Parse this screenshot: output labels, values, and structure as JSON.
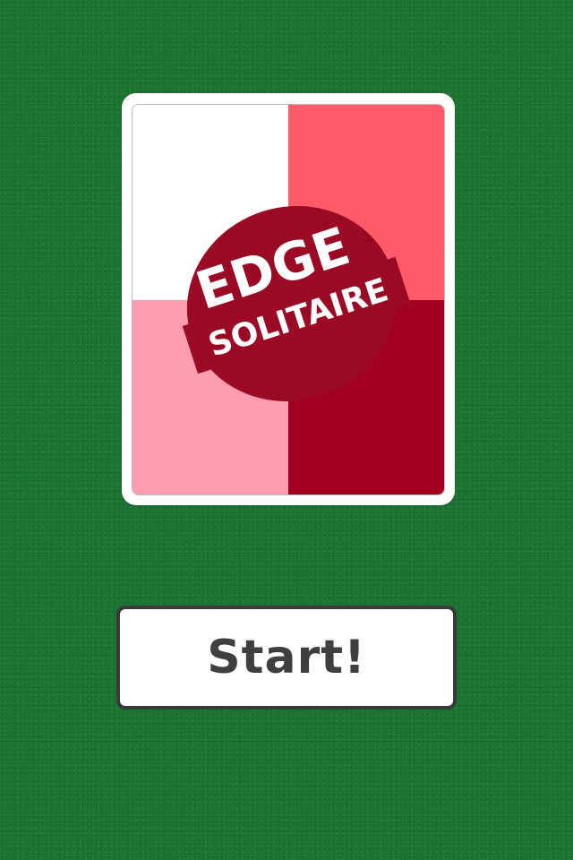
{
  "app": {
    "logo": {
      "line1": "EDGE",
      "line2": "SOLITAIRE"
    }
  },
  "colors": {
    "felt": "#1c7a34",
    "quad_top_left": "#ffffff",
    "quad_top_right": "#ff5a68",
    "quad_bottom_left": "#ff9cb0",
    "quad_bottom_right": "#a30021",
    "emblem": "#9b0a24",
    "button_border": "#3a3a3a",
    "button_text": "#3f3f3f"
  },
  "icons": {
    "card_back": "card-back-icon"
  },
  "start_button": {
    "label": "Start!"
  }
}
